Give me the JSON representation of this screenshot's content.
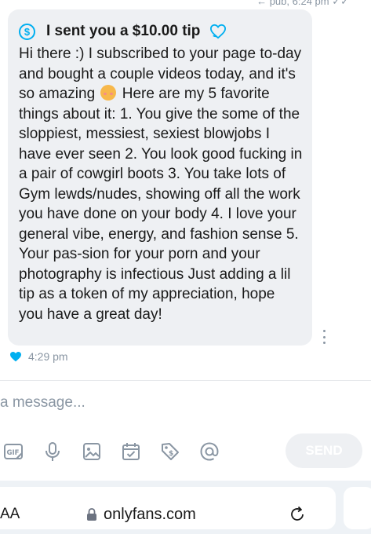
{
  "header": {
    "cut_off_text": "← pub, 6:24 pm ✓✓"
  },
  "tip": {
    "icon": "dollar-circle-icon",
    "currency_symbol": "$",
    "label": "I sent you a $10.00 tip",
    "decoration_icon": "heart-outline-icon"
  },
  "message": {
    "text_before_emoji": "Hi there :) I subscribed to your page to-day and bought a couple videos today, and it's so amazing",
    "emoji": "smiling-face-with-hearts",
    "text_after_emoji": " Here are my 5 favorite things about it: 1. You give the some of the sloppiest, messiest, sexiest blowjobs I have ever seen 2. You look good fucking in a pair of cowgirl boots 3. You take lots of Gym lewds/nudes, showing off all the work you have done on your body 4. I love your general vibe, energy, and fashion sense 5. Your pas-sion for your porn and your photography is infectious Just adding a lil tip as a token of my appreciation, hope you have a great day!",
    "time": "4:29 pm",
    "liked": true
  },
  "composer": {
    "placeholder": "a message...",
    "tools": [
      "gif-icon",
      "microphone-icon",
      "image-icon",
      "calendar-icon",
      "price-tag-icon",
      "at-sign-icon"
    ],
    "send_label": "SEND"
  },
  "browser": {
    "text_size_label": "AA",
    "url": "onlyfans.com"
  },
  "colors": {
    "accent": "#00aff0",
    "bubble_bg": "#eef0f3",
    "muted_text": "#8a96a3",
    "text": "#1a1a1a"
  }
}
